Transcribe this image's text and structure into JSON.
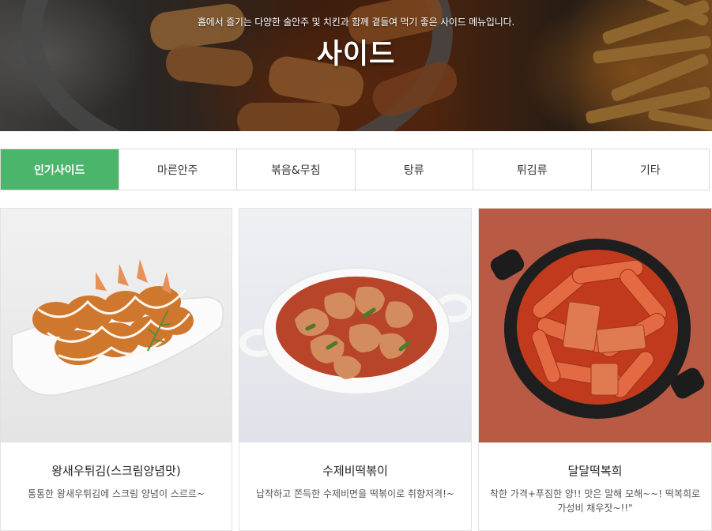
{
  "hero": {
    "subtitle": "홈에서 즐기는 다양한 술안주 및 치킨과 함께 곁들여 먹기 좋은 사이드 메뉴입니다.",
    "title": "사이드"
  },
  "tabs": [
    {
      "label": "인기사이드",
      "active": true
    },
    {
      "label": "마른안주",
      "active": false
    },
    {
      "label": "볶음&무침",
      "active": false
    },
    {
      "label": "탕류",
      "active": false
    },
    {
      "label": "튀김류",
      "active": false
    },
    {
      "label": "기타",
      "active": false
    }
  ],
  "colors": {
    "accent_green": "#4cb56c",
    "sauce_red": "#c23a1e",
    "card3_background": "#b85a44"
  },
  "products": [
    {
      "name": "왕새우튀김(스크림양념맛)",
      "description": "통통한 왕새우튀김에 스크림 양념이 스르르~",
      "image": "fried-shrimp-photo"
    },
    {
      "name": "수제비떡볶이",
      "description": "납작하고 쫀득한 수제비면을 떡볶이로 취향저격!~",
      "image": "sujebi-tteokbokki-photo"
    },
    {
      "name": "달달떡복희",
      "description": "착한 가격+푸짐한 양!! 맛은 말해 모해~~! 떡복희로 가성비 채우잣~!!\"",
      "image": "dal-dal-tteokbokki-photo"
    }
  ]
}
